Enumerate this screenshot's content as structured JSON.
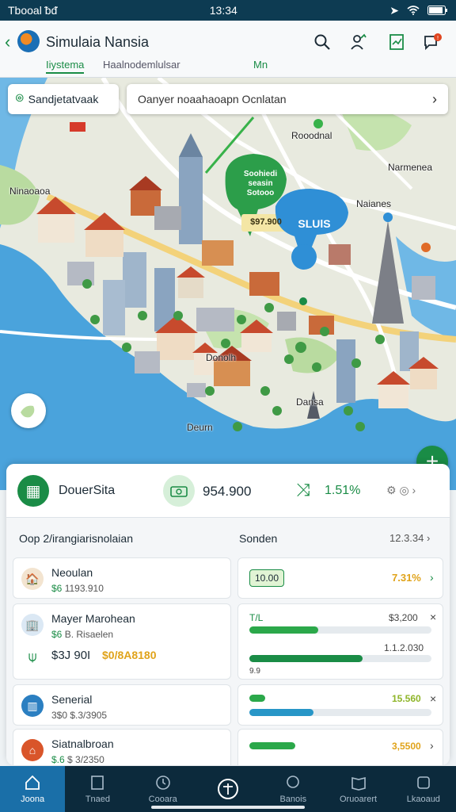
{
  "status_bar": {
    "carrier": "Tbooal ᵬᵭ",
    "time": "13:34"
  },
  "app": {
    "title": "Simulaia Nansia",
    "tabs": [
      "Iiystema",
      "Haalnodemlulsar",
      "Mn"
    ]
  },
  "map": {
    "location_chip": "Sandjetatvaak",
    "search_text": "Oanyer noaahaoapn Ocnlatan",
    "labels": [
      "Rooodnal",
      "Ninaoaoa",
      "Narmenea",
      "Naianes",
      "Donolh",
      "Dansa",
      "Deurn"
    ],
    "callout_green": {
      "line1": "Soohiedi",
      "line2": "seasin",
      "line3": "Sotooo",
      "price": "$97.900"
    },
    "callout_blue": "SLUlS"
  },
  "panel": {
    "stats": {
      "name": "DouerSita",
      "cash": "954.900",
      "rate": "1.51%"
    },
    "section": {
      "left": "Oop 2/irangiarisnolaian",
      "mid": "Sonden",
      "right": "12.3.34"
    },
    "properties": [
      {
        "name": "Neoulan",
        "sub": "$6",
        "sub2": "1193.910"
      },
      {
        "name": "Mayer Marohean",
        "sub": "$6",
        "sub2": "B. Risaelen",
        "line2a": "$3J 90I",
        "line2b": "$0/8A8180"
      },
      {
        "name": "Senerial",
        "sub": "3$0",
        "sub2": "$.3/3905"
      },
      {
        "name": "Siatnalbroan",
        "sub": "$.6",
        "sub2": "$ 3/2350"
      }
    ],
    "metrics": [
      {
        "tag": "10.00",
        "value": "7.31%",
        "value_color": "#e0a31a"
      },
      {
        "label": "T/L",
        "value": "$3,200",
        "value2": "1.1.2.030",
        "foot": "9.9",
        "fill1": 0.38,
        "fill2": 0.62
      },
      {
        "value": "15.560",
        "value_color": "#8fb52a",
        "fill": 0.35
      },
      {
        "value": "3,5500",
        "value_color": "#e0a31a",
        "fill": 0.36
      }
    ]
  },
  "bottom_nav": [
    "Joona",
    "Tnaed",
    "Cooara",
    "",
    "Banois",
    "Oruoarert",
    "Lkaoaud"
  ]
}
